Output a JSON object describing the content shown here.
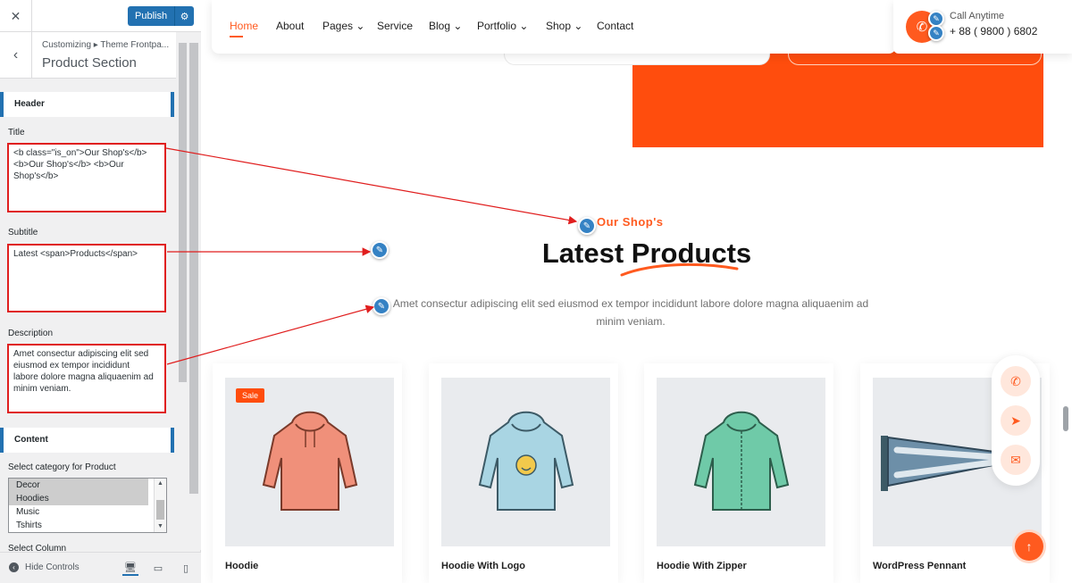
{
  "customizer": {
    "close_icon": "close-icon",
    "publish_label": "Publish",
    "breadcrumb": "Customizing ▸ Theme Frontpa...",
    "section_title": "Product Section",
    "header_group": "Header",
    "title_label": "Title",
    "title_value": "<b class=\"is_on\">Our Shop's</b>\n<b>Our Shop's</b> <b>Our\nShop's</b>",
    "subtitle_label": "Subtitle",
    "subtitle_value": "Latest <span>Products</span>",
    "description_label": "Description",
    "description_value": "Amet consectur adipiscing elit sed\neiusmod ex tempor incididunt\nlabore dolore magna aliquaenim ad\nminim veniam.",
    "content_group": "Content",
    "category_label": "Select category for Product",
    "categories": [
      {
        "name": "Decor",
        "selected": true
      },
      {
        "name": "Hoodies",
        "selected": true
      },
      {
        "name": "Music",
        "selected": false
      },
      {
        "name": "Tshirts",
        "selected": false
      }
    ],
    "column_label": "Select Column",
    "hide_controls": "Hide Controls"
  },
  "nav": {
    "items": [
      "Home",
      "About",
      "Pages",
      "Service",
      "Blog",
      "Portfolio",
      "Shop",
      "Contact"
    ],
    "active": "Home",
    "call_label": "Call Anytime",
    "call_number": "+ 88 ( 9800 ) 6802"
  },
  "section": {
    "kicker": "Our Shop's",
    "title": "Latest Products",
    "description": "Amet consectur adipiscing elit sed eiusmod ex tempor incididunt labore dolore magna aliquaenim ad minim veniam."
  },
  "products": [
    {
      "name": "Hoodie",
      "sale": "Sale",
      "color": "#f0907a"
    },
    {
      "name": "Hoodie With Logo",
      "sale": "",
      "color": "#a9d5e3"
    },
    {
      "name": "Hoodie With Zipper",
      "sale": "",
      "color": "#6fcaa8"
    },
    {
      "name": "WordPress Pennant",
      "sale": "",
      "color": "#6d8fa8"
    }
  ],
  "colors": {
    "accent": "#ff5a1f",
    "wp_blue": "#2271b1",
    "annotation_red": "#e01e1e"
  }
}
